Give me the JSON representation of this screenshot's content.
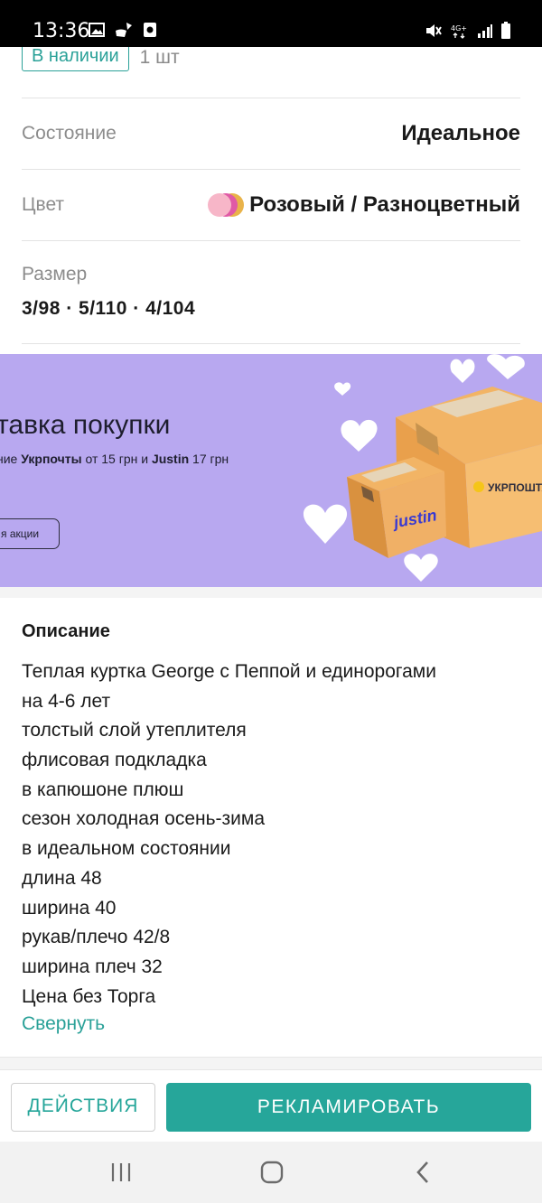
{
  "status_bar": {
    "time": "13:36",
    "left_icons": [
      "gallery-icon",
      "broom-icon",
      "camera-square-icon"
    ],
    "right_icons": [
      "mute-icon",
      "4g-lte-icon",
      "signal-icon",
      "battery-icon"
    ],
    "network": "4G+"
  },
  "listing": {
    "stock_badge": "В наличии",
    "stock_count": "1 шт",
    "condition_label": "Состояние",
    "condition_value": "Идеальное",
    "color_label": "Цвет",
    "color_value": "Розовый / Разноцветный",
    "color_swatches": [
      "#f7b6c8",
      "#e05aa6",
      "#e9b34a"
    ],
    "size_label": "Размер",
    "size_values": "3/98  ·  5/110  ·  4/104"
  },
  "banner": {
    "title": "тавка покупки",
    "subtitle_prefix": "ние ",
    "subtitle_brand1": "Укрпочты",
    "subtitle_mid": " от 15 грн и ",
    "subtitle_brand2": "Justin",
    "subtitle_suffix": " 17 грн",
    "button_label": "я акции",
    "box_small_logo": "justin",
    "box_large_logo": "УКРПОШТА",
    "background_color": "#b8a8f0"
  },
  "description": {
    "title": "Описание",
    "lines": [
      "Теплая куртка George с Пеппой и единорогами",
      "на 4-6 лет",
      "толстый слой утеплителя",
      "флисовая подкладка",
      "в капюшоне плюш",
      "сезон холодная осень-зима",
      "в идеальном состоянии",
      "длина 48",
      "ширина 40",
      "рукав/плечо 42/8",
      "ширина плеч 32",
      "Цена без Торга"
    ],
    "collapse_label": "Свернуть"
  },
  "actions": {
    "actions_label": "ДЕЙСТВИЯ",
    "promote_label": "РЕКЛАМИРОВАТЬ",
    "accent_color": "#26a69a"
  },
  "nav_bar": {
    "buttons": [
      "recent-apps-icon",
      "home-icon",
      "back-icon"
    ]
  }
}
